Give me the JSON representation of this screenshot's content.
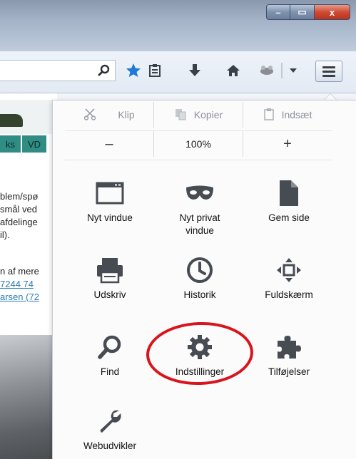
{
  "window": {
    "min_label": "–",
    "max_label": "▭",
    "close_label": "x"
  },
  "toolbar": {
    "icons": [
      "search-icon",
      "bookmark-star-icon",
      "reading-list-icon",
      "download-icon",
      "home-icon",
      "extension-icon",
      "dropdown-icon",
      "menu-icon"
    ],
    "accent": "#1f7ad6"
  },
  "page": {
    "tabs": [
      "ks",
      "VD"
    ],
    "lines": [
      "blem/spø",
      "smål ved",
      "afdelinge",
      "il).",
      "n af mere",
      "7244 74",
      "arsen (72"
    ]
  },
  "menu": {
    "edit": {
      "cut": "Klip",
      "copy": "Kopier",
      "paste": "Indsæt"
    },
    "zoom": {
      "minus": "–",
      "level": "100%",
      "plus": "+"
    },
    "items": [
      {
        "label": "Nyt vindue",
        "icon": "new-window-icon"
      },
      {
        "label": "Nyt privat vindue",
        "icon": "private-mask-icon"
      },
      {
        "label": "Gem side",
        "icon": "save-page-icon"
      },
      {
        "label": "Udskriv",
        "icon": "printer-icon"
      },
      {
        "label": "Historik",
        "icon": "history-clock-icon"
      },
      {
        "label": "Fuldskærm",
        "icon": "fullscreen-icon"
      },
      {
        "label": "Find",
        "icon": "search-icon"
      },
      {
        "label": "Indstillinger",
        "icon": "gear-icon"
      },
      {
        "label": "Tilføjelser",
        "icon": "puzzle-icon"
      },
      {
        "label": "Webudvikler",
        "icon": "wrench-icon"
      }
    ],
    "highlight_color": "#d8141c"
  }
}
